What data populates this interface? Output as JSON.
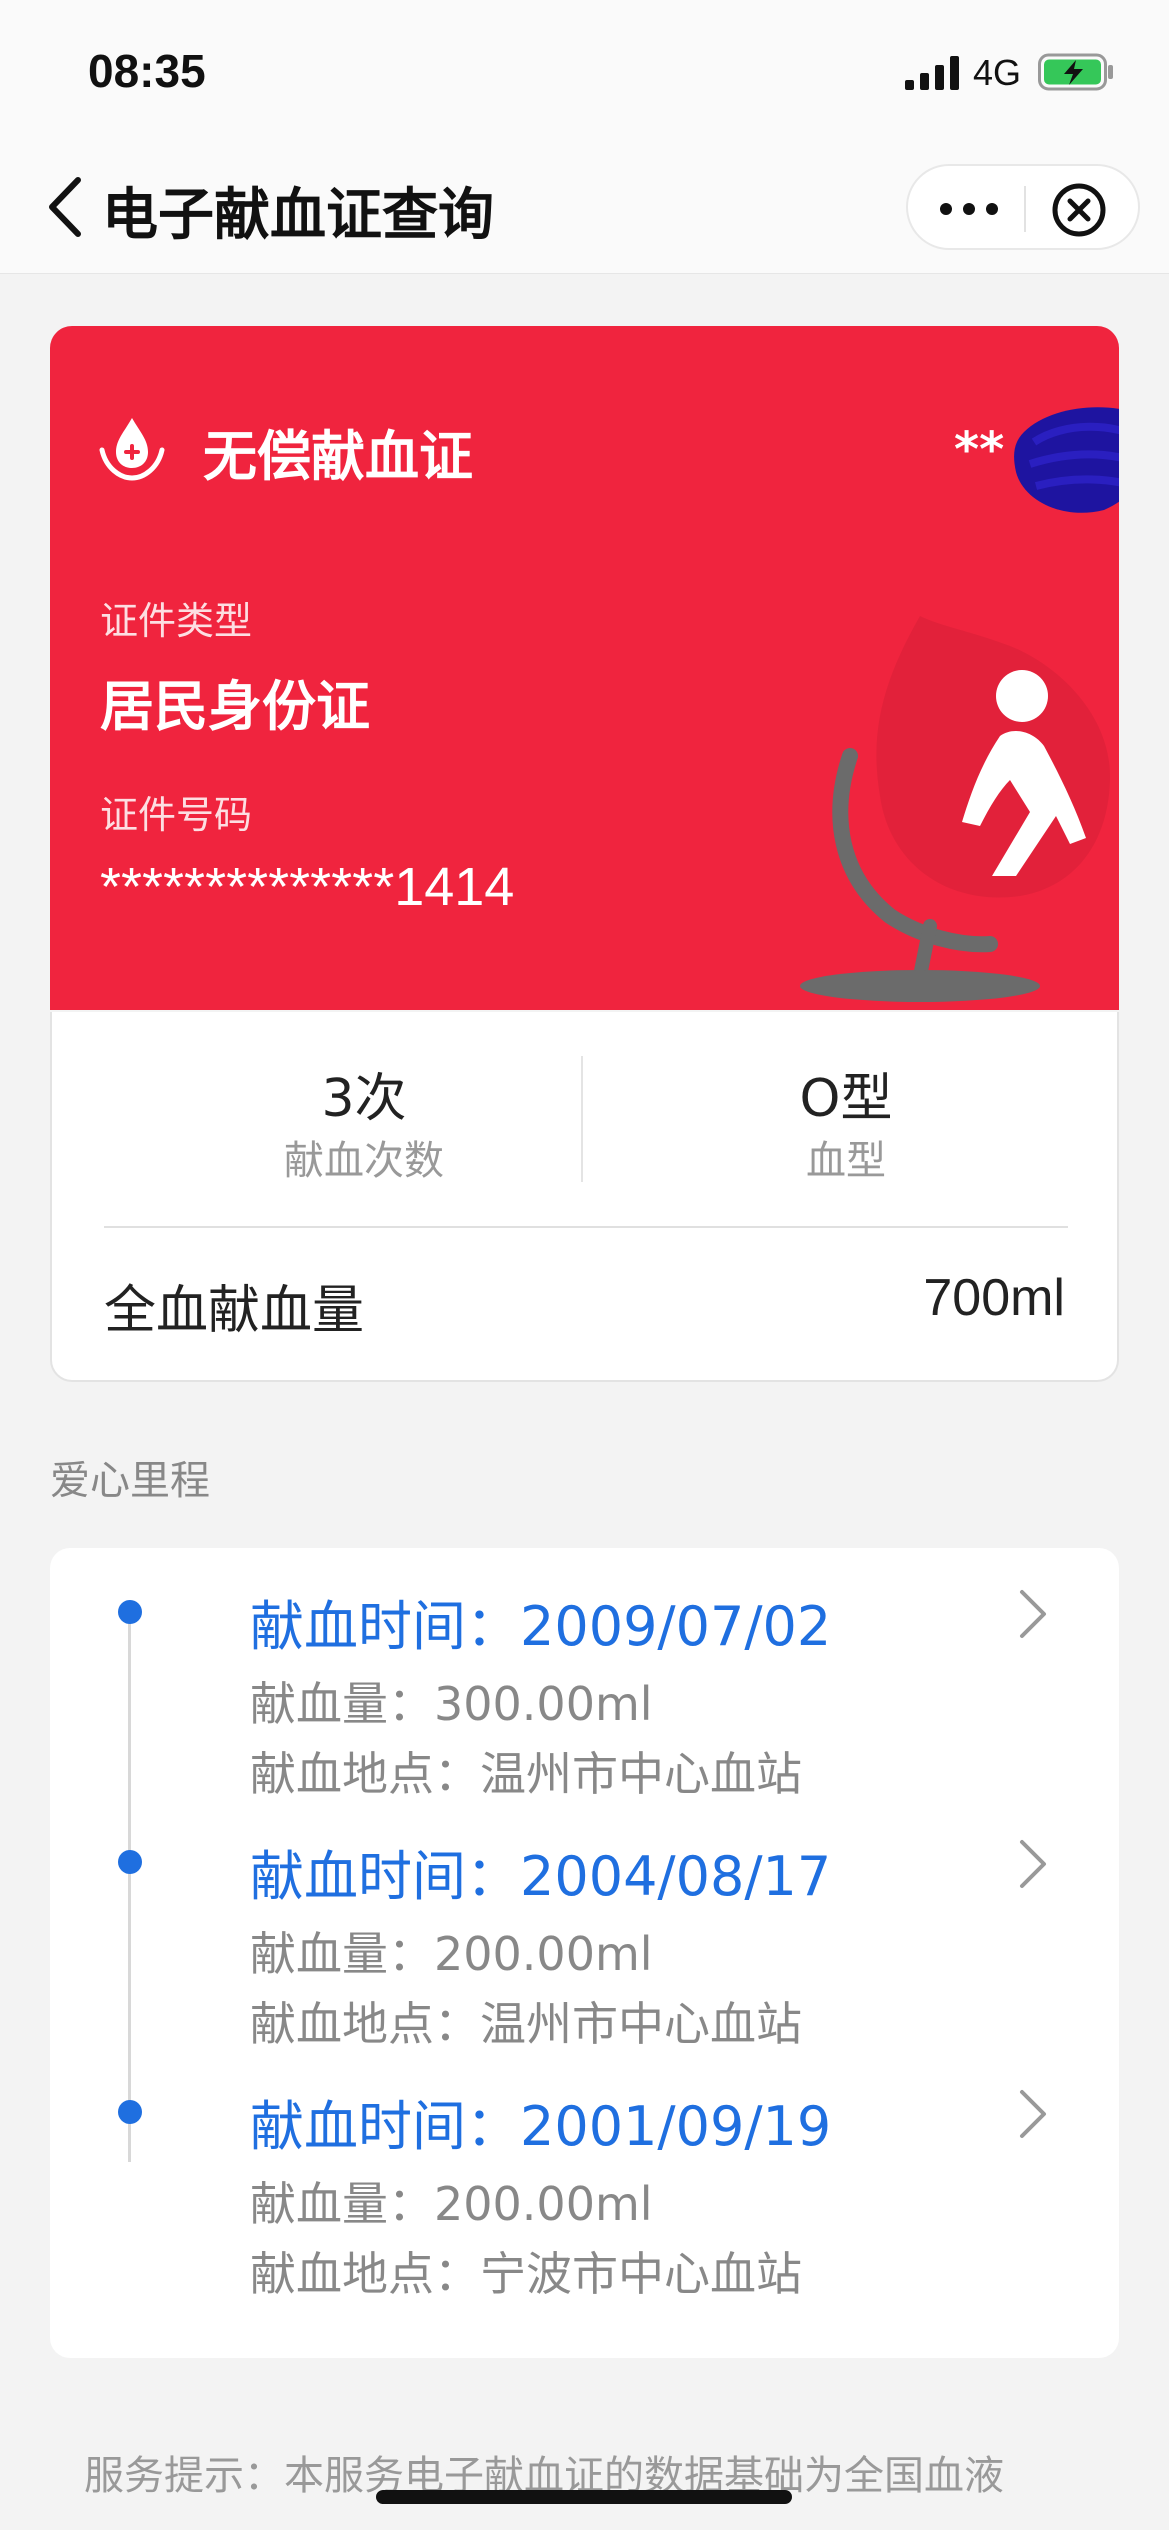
{
  "status_bar": {
    "time": "08:35",
    "network": "4G"
  },
  "nav": {
    "title": "电子献血证查询"
  },
  "card": {
    "title": "无偿献血证",
    "name_masked": "**",
    "id_type_label": "证件类型",
    "id_type_value": "居民身份证",
    "id_number_label": "证件号码",
    "id_number_value": "**************1414",
    "color": "#f0243e"
  },
  "stats": {
    "donation_count_value": "3次",
    "donation_count_label": "献血次数",
    "blood_type_value": "O型",
    "blood_type_label": "血型",
    "total_label": "全血献血量",
    "total_value": "700ml"
  },
  "timeline": {
    "title": "爱心里程",
    "items": [
      {
        "date": "献血时间：2009/07/02",
        "amount": "献血量：300.00ml",
        "place": "献血地点：温州市中心血站"
      },
      {
        "date": "献血时间：2004/08/17",
        "amount": "献血量：200.00ml",
        "place": "献血地点：温州市中心血站"
      },
      {
        "date": "献血时间：2001/09/19",
        "amount": "献血量：200.00ml",
        "place": "献血地点：宁波市中心血站"
      }
    ]
  },
  "footer": {
    "note": "服务提示：本服务电子献血证的数据基础为全国血液"
  },
  "icons": [
    "signal-icon",
    "battery-icon",
    "back-icon",
    "more-icon",
    "close-icon",
    "blood-drop-logo-icon",
    "chevron-right-icon"
  ],
  "colors": {
    "accent_blue": "#1f6fe0",
    "card_red": "#f0243e"
  }
}
